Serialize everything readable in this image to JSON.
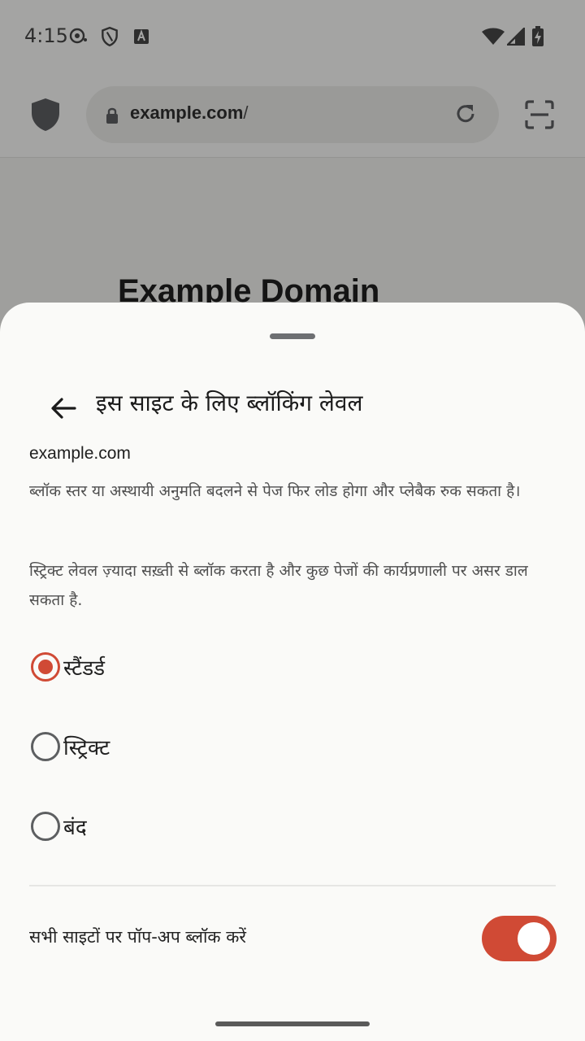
{
  "status_bar": {
    "time": "4:15",
    "icons": [
      "record-icon",
      "shield-outline-icon",
      "font-a-icon",
      "wifi-icon",
      "signal-icon",
      "battery-charging-icon"
    ]
  },
  "browser": {
    "url_host": "example.com",
    "url_path": "/",
    "icons": [
      "shield-icon",
      "lock-icon",
      "reload-icon",
      "scan-icon"
    ]
  },
  "page": {
    "heading": "Example Domain"
  },
  "sheet": {
    "title": "इस साइट के लिए ब्लॉकिंग लेवल",
    "domain": "example.com",
    "description_1": "ब्लॉक स्तर या अस्थायी अनुमति बदलने से पेज फिर लोड होगा और प्लेबैक रुक सकता है।",
    "description_2": "स्ट्रिक्ट लेवल ज़्यादा सख़्ती से ब्लॉक करता है और कुछ पेजों की कार्यप्रणाली पर असर डाल सकता है.",
    "options": [
      {
        "label": "स्टैंडर्ड",
        "selected": true
      },
      {
        "label": "स्ट्रिक्ट",
        "selected": false
      },
      {
        "label": "बंद",
        "selected": false
      }
    ],
    "popup_block_label": "सभी साइटों पर पॉप-अप ब्लॉक करें",
    "popup_block_enabled": true
  },
  "colors": {
    "accent": "#d04a35",
    "sheet_bg": "#fafaf8",
    "scrim": "#9f9f9d"
  }
}
